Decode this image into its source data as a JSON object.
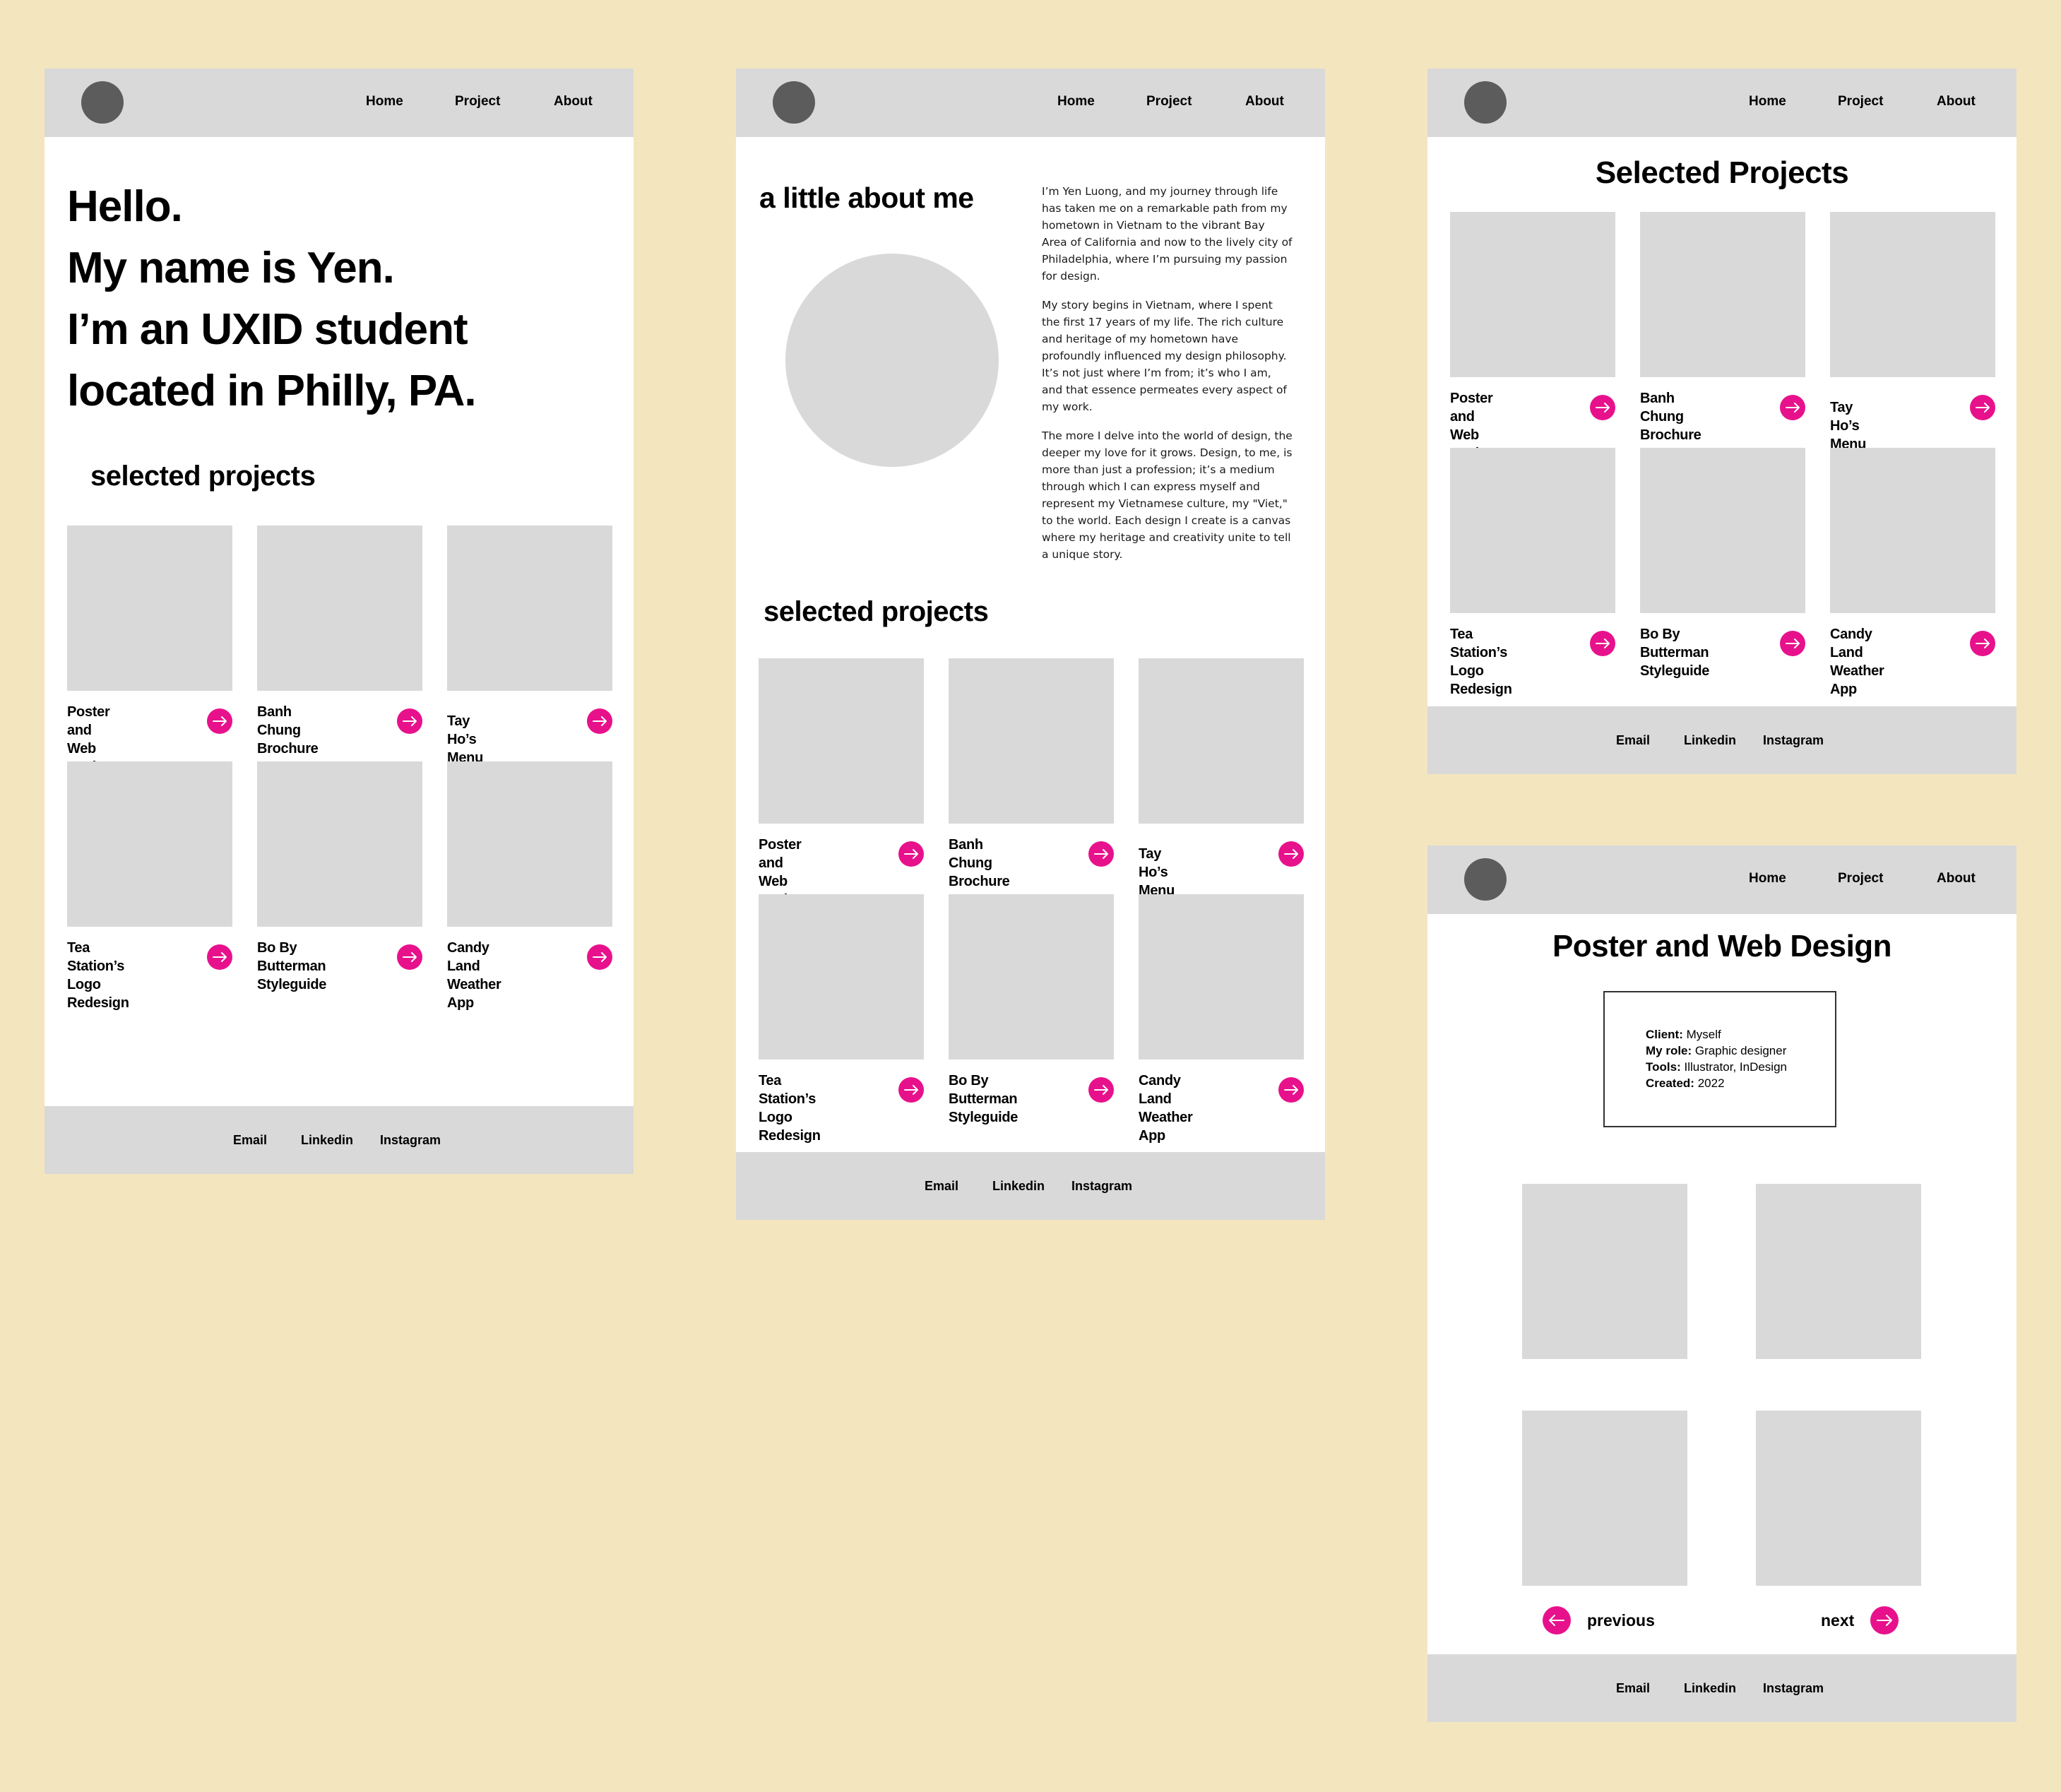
{
  "colors": {
    "accent": "#e8118c",
    "canvas": "#f3e5be",
    "placeholder": "#d9d9d9",
    "logo": "#5c5c5c"
  },
  "nav": {
    "home": "Home",
    "project": "Project",
    "about": "About"
  },
  "footer": {
    "email": "Email",
    "linkedin": "Linkedin",
    "instagram": "Instagram"
  },
  "projects": [
    {
      "line1": "Poster and",
      "line2": "Web Design"
    },
    {
      "line1": "Banh Chung",
      "line2": "Brochure"
    },
    {
      "line1": "Tay Ho’s Menu",
      "line2": ""
    },
    {
      "line1": "Tea Station’s",
      "line2": "Logo Redesign"
    },
    {
      "line1": "Bo By Butterman",
      "line2": "Styleguide"
    },
    {
      "line1": "Candy Land",
      "line2": "Weather App"
    }
  ],
  "home": {
    "hero": [
      "Hello.",
      "My name is Yen.",
      "I’m an UXID student",
      "located in Philly, PA."
    ],
    "section_title": "selected projects"
  },
  "about": {
    "title": "a little about me",
    "paragraphs": [
      "I’m Yen Luong, and my journey through life has taken me on a remarkable path from my hometown in Vietnam to the vibrant Bay Area of California and now to the lively city of Philadelphia, where I’m pursuing my passion for design.",
      "My story begins in Vietnam, where I spent the first 17 years of my life. The rich culture and heritage of my hometown have profoundly influenced my design philosophy. It’s not just where I’m from; it’s who I am, and that essence permeates every aspect of my work.",
      "The more I delve into the world of design, the deeper my love for it grows. Design, to me, is more than just a profession; it’s a medium through which I can express myself and represent my Vietnamese culture, my \"Viet,\" to the world. Each design I create is a canvas where my heritage and creativity unite to tell a unique story."
    ],
    "section_title": "selected projects"
  },
  "projects_page": {
    "title": "Selected Projects"
  },
  "detail": {
    "title": "Poster and Web Design",
    "meta": [
      {
        "label": "Client:",
        "value": "Myself"
      },
      {
        "label": "My role:",
        "value": "Graphic designer"
      },
      {
        "label": "Tools:",
        "value": "Illustrator, InDesign"
      },
      {
        "label": "Created:",
        "value": "2022"
      }
    ],
    "previous": "previous",
    "next": "next"
  }
}
